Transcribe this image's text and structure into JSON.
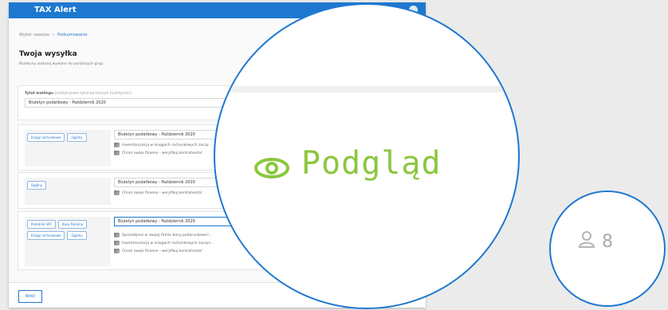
{
  "app": {
    "title": "TAX Alert"
  },
  "breadcrumb": {
    "step1": "Wybór newsów",
    "sep": ">",
    "step2": "Podsumowanie"
  },
  "page": {
    "title": "Twoja wysyłka",
    "subtitle": "Biuletyny zostaną wysłane do poniższych grup."
  },
  "mailing": {
    "label": "Tytuł mailingu",
    "hint": "(nadaje jeden tytuł poniższym biuletynom)",
    "value": "Biuletyn podatkowy - Październik 2020"
  },
  "groups": [
    {
      "tags": [
        "Księgi rachunkowe",
        "Ogólny"
      ],
      "bulletin_title": "Biuletyn podatkowy - Październik 2020",
      "articles": [
        "Inwentaryzacja w księgach rachunkowych zaczy...",
        "Chroń swoje finanse - weryfikuj kontrahenta!"
      ]
    },
    {
      "tags": [
        "Ogólny"
      ],
      "bulletin_title": "Biuletyn podatkowy - Październik 2020",
      "articles": [
        "Chroń swoje finanse - weryfikuj kontrahenta!"
      ]
    },
    {
      "tags": [
        "Podatnik VAT",
        "Kasa fiskalna",
        "Księgi rachunkowe",
        "Ogólny"
      ],
      "bulletin_title": "Biuletyn podatkowy - Październik 2020",
      "articles": [
        "Sprzedajesz w swojej firmie bony podarunkowe?...",
        "Inwentaryzacja w księgach rachunkowych zaczyn...",
        "Chroń swoje finanse - weryfikuj kontrahenta!"
      ]
    }
  ],
  "footer": {
    "back_label": "Wróć"
  },
  "zoom_preview": {
    "label": "Podgląd",
    "icon": "eye-icon"
  },
  "zoom_recipients": {
    "count": "8",
    "icon": "user-icon"
  },
  "colors": {
    "brand_blue": "#1e78d0",
    "preview_green": "#8cc63f"
  }
}
